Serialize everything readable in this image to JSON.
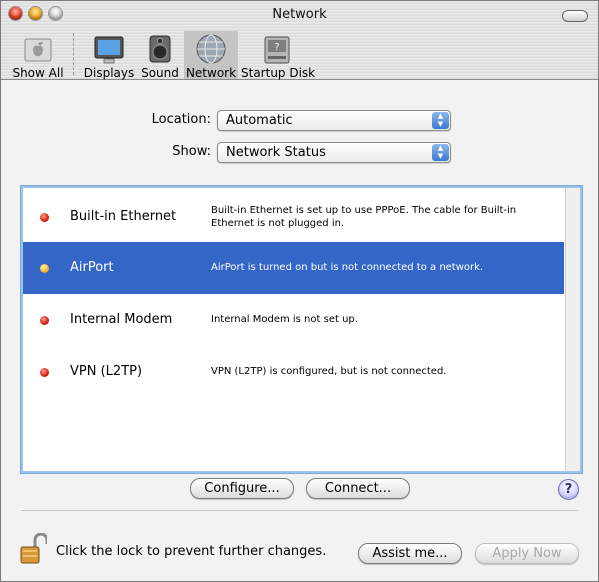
{
  "window": {
    "title": "Network"
  },
  "toolbar": {
    "items": [
      {
        "label": "Show All",
        "icon": "apple-icon"
      },
      {
        "label": "Displays",
        "icon": "display-icon"
      },
      {
        "label": "Sound",
        "icon": "speaker-icon"
      },
      {
        "label": "Network",
        "icon": "network-globe-icon",
        "selected": true
      },
      {
        "label": "Startup Disk",
        "icon": "disk-icon"
      }
    ]
  },
  "form": {
    "location_label": "Location:",
    "location_value": "Automatic",
    "show_label": "Show:",
    "show_value": "Network Status"
  },
  "services": [
    {
      "name": "Built-in Ethernet",
      "status": "red",
      "description": "Built-in Ethernet is set up to use PPPoE. The cable for Built-in Ethernet is not plugged in."
    },
    {
      "name": "AirPort",
      "status": "yellow",
      "selected": true,
      "description": "AirPort is turned on but is not connected to a network."
    },
    {
      "name": "Internal Modem",
      "status": "red",
      "description": "Internal Modem is not set up."
    },
    {
      "name": "VPN (L2TP)",
      "status": "red",
      "description": "VPN (L2TP) is configured, but is not connected."
    }
  ],
  "buttons": {
    "configure": "Configure...",
    "connect": "Connect...",
    "help": "?",
    "assist": "Assist me...",
    "apply": "Apply Now"
  },
  "lock": {
    "label": "Click the lock to prevent further changes."
  },
  "colors": {
    "selection": "#3466c8",
    "focus_ring": "#9cc3e9"
  }
}
